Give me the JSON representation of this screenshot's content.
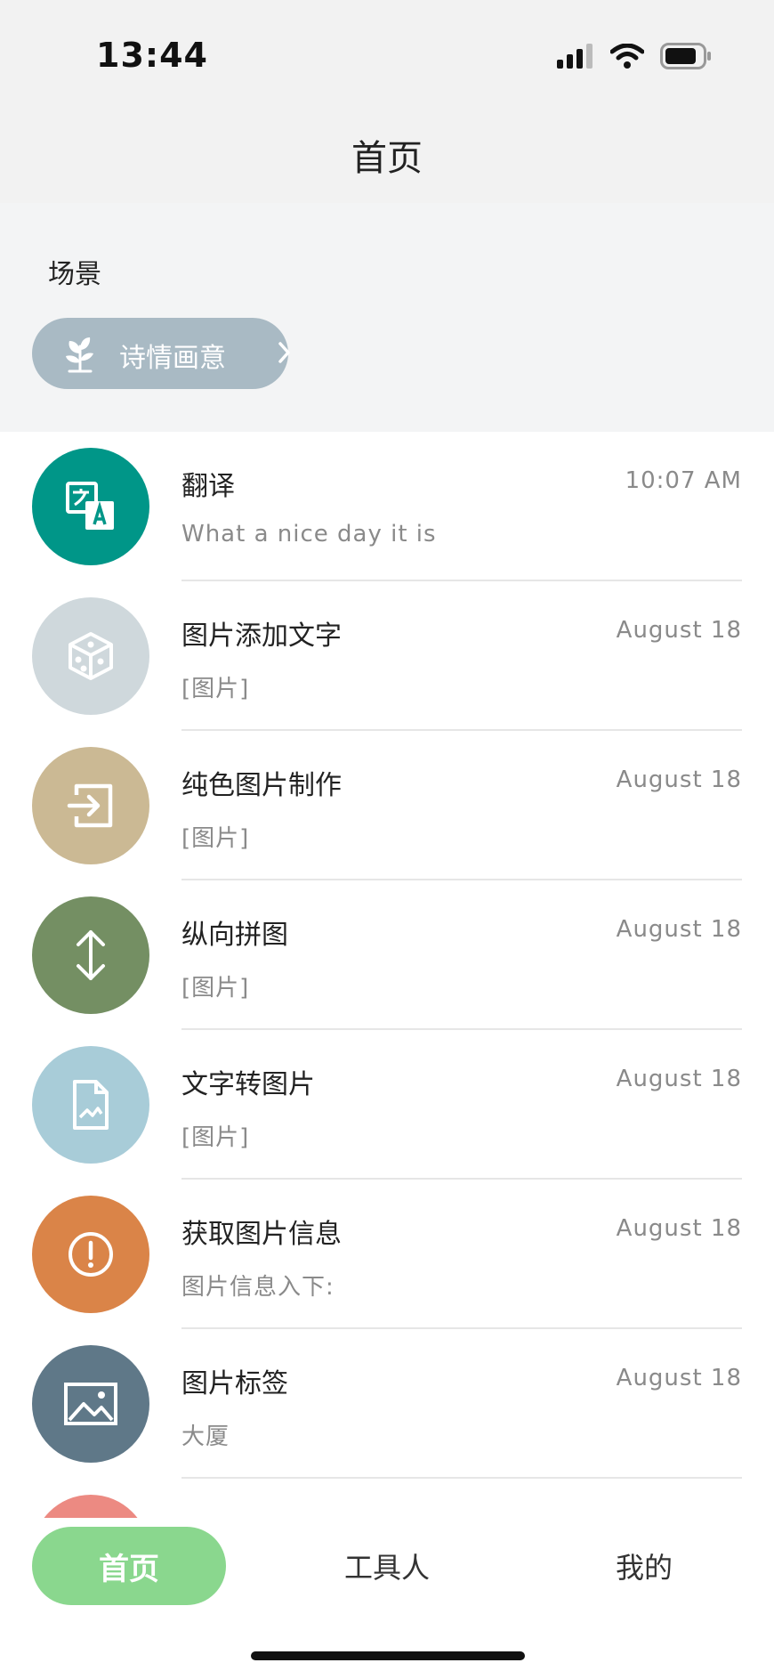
{
  "status": {
    "time": "13:44"
  },
  "nav": {
    "title": "首页"
  },
  "scene": {
    "label": "场景",
    "chip_label": "诗情画意"
  },
  "items": [
    {
      "title": "翻译",
      "time": "10:07 AM",
      "subtitle": "What a nice day it is",
      "color": "#009688",
      "icon": "translate-icon"
    },
    {
      "title": "图片添加文字",
      "time": "August 18",
      "subtitle": "[图片]",
      "color": "#cfd8dc",
      "icon": "dice-icon"
    },
    {
      "title": "纯色图片制作",
      "time": "August 18",
      "subtitle": "[图片]",
      "color": "#cbb994",
      "icon": "login-icon"
    },
    {
      "title": "纵向拼图",
      "time": "August 18",
      "subtitle": "[图片]",
      "color": "#748f63",
      "icon": "vertical-arrows-icon"
    },
    {
      "title": "文字转图片",
      "time": "August 18",
      "subtitle": "[图片]",
      "color": "#a8ccd8",
      "icon": "image-file-icon"
    },
    {
      "title": "获取图片信息",
      "time": "August 18",
      "subtitle": "图片信息入下:",
      "color": "#da8448",
      "icon": "alert-circle-icon"
    },
    {
      "title": "图片标签",
      "time": "August 18",
      "subtitle": "大厦",
      "color": "#5f7888",
      "icon": "image-icon"
    },
    {
      "title": "",
      "time": "",
      "subtitle": "",
      "color": "#ec8a82",
      "icon": "partial-icon"
    }
  ],
  "tabs": {
    "home": "首页",
    "tools": "工具人",
    "mine": "我的"
  },
  "colors": {
    "accent": "#8ad78e",
    "chip": "#a9bac4"
  }
}
